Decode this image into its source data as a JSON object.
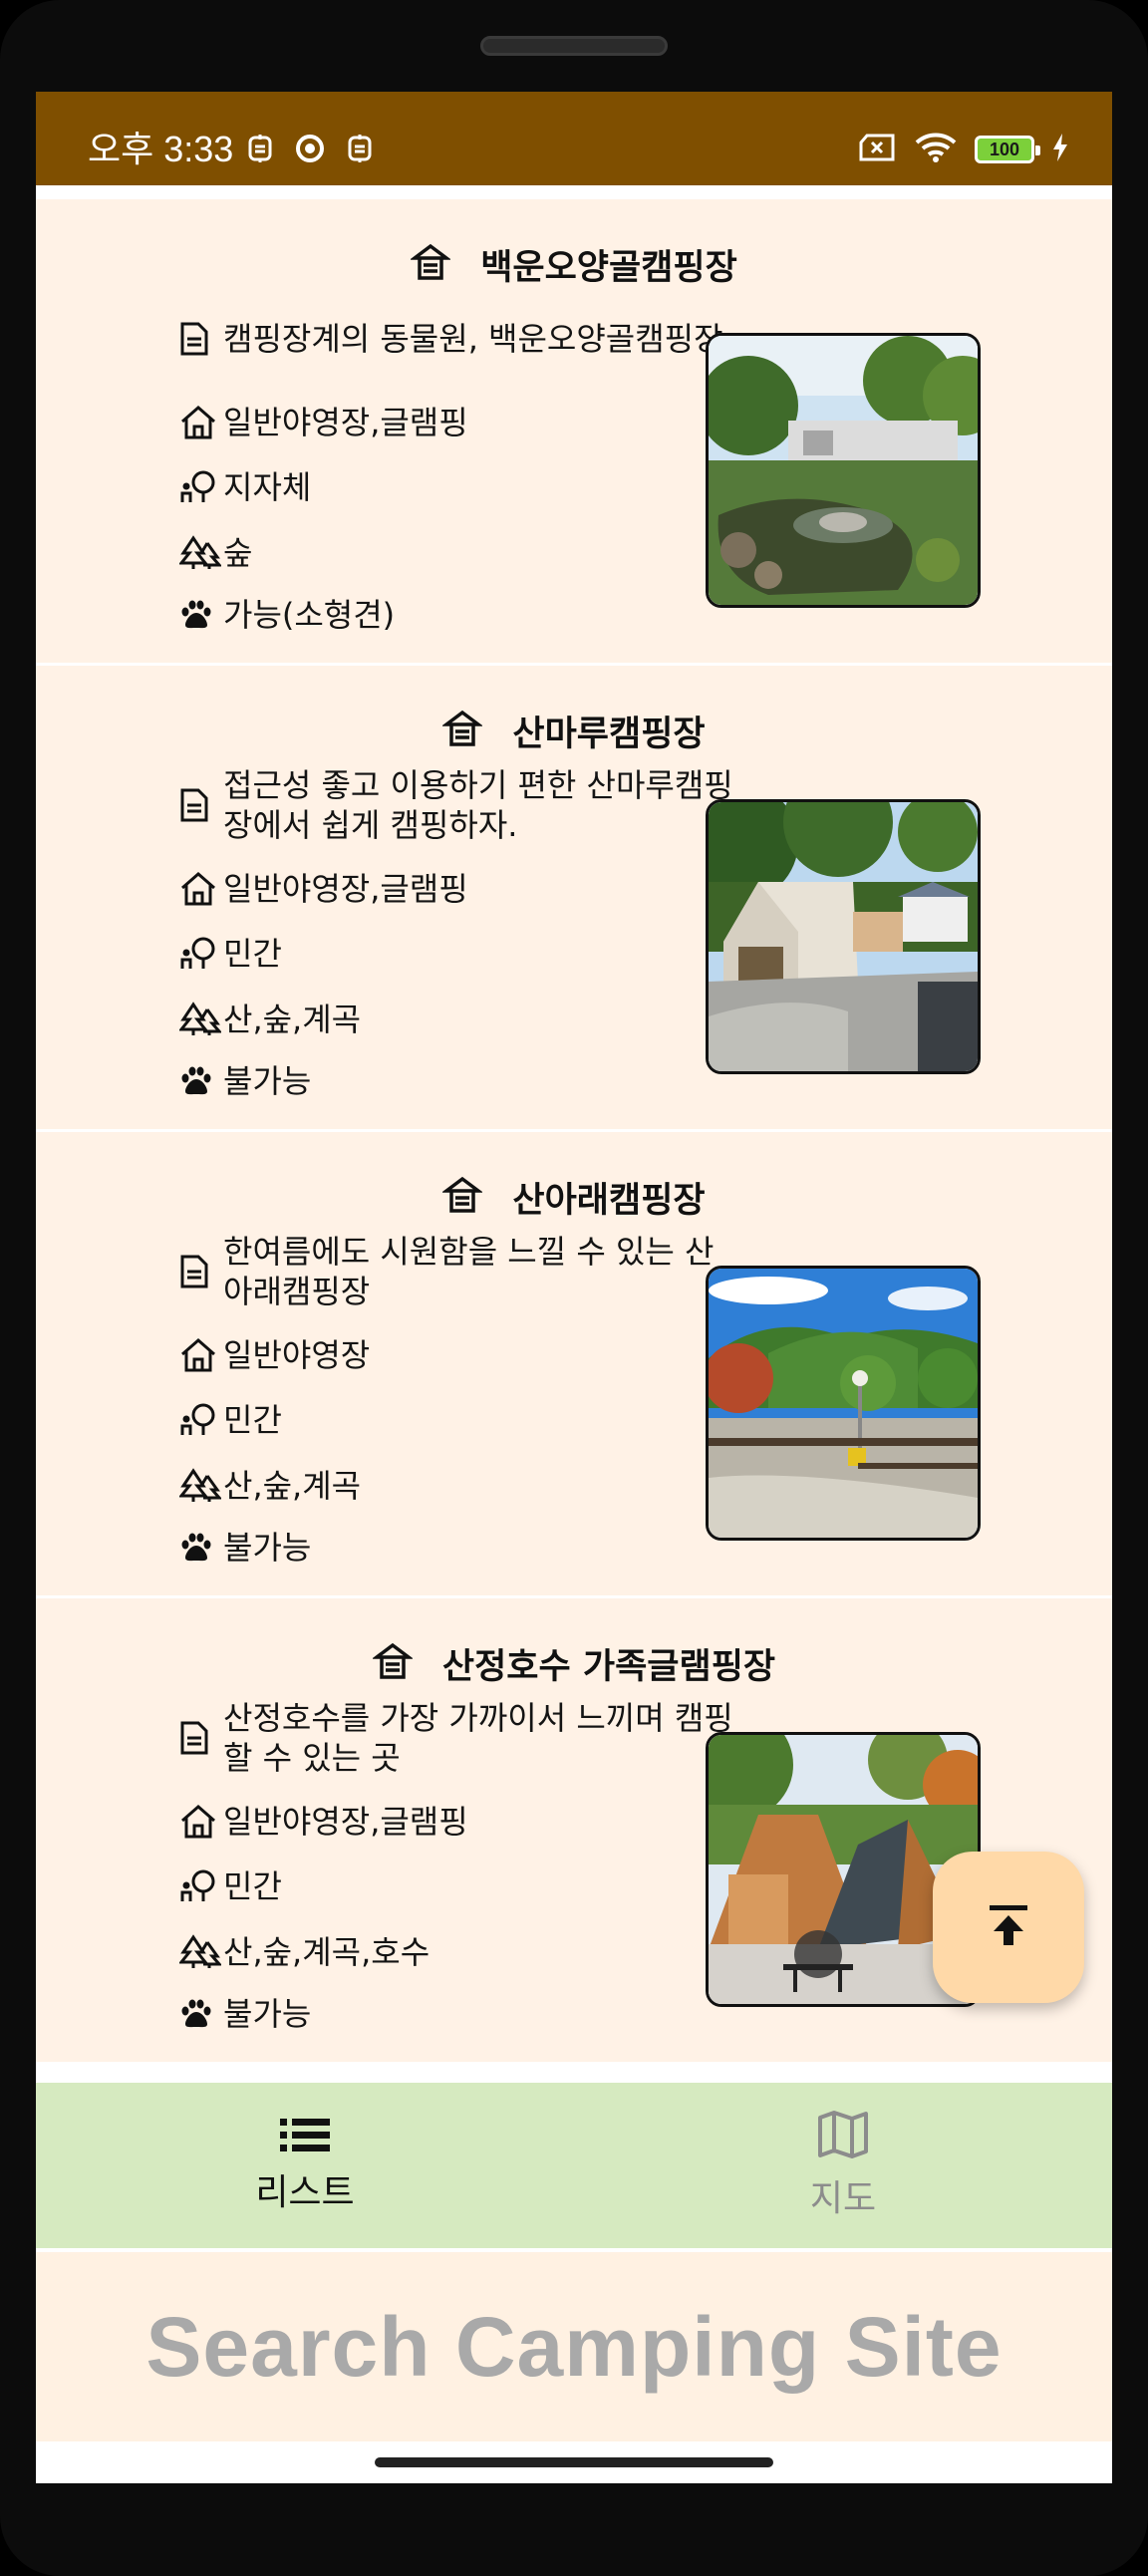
{
  "status_bar": {
    "time": "오후 3:33",
    "battery": "100",
    "background": "#7f4f00"
  },
  "sites": [
    {
      "name": "백운오양골캠핑장",
      "description": "캠핑장계의 동물원, 백운오양골캠핑장",
      "type": "일반야영장,글램핑",
      "owner": "지자체",
      "environment": "숲",
      "pets": "가능(소형견)"
    },
    {
      "name": "산마루캠핑장",
      "description": "접근성 좋고 이용하기 편한 산마루캠핑장에서 쉽게 캠핑하자.",
      "type": "일반야영장,글램핑",
      "owner": "민간",
      "environment": "산,숲,계곡",
      "pets": "불가능"
    },
    {
      "name": "산아래캠핑장",
      "description": "한여름에도 시원함을 느낄 수 있는 산아래캠핑장",
      "type": "일반야영장",
      "owner": "민간",
      "environment": "산,숲,계곡",
      "pets": "불가능"
    },
    {
      "name": "산정호수 가족글램핑장",
      "description": "산정호수를 가장 가까이서 느끼며 캠핑할 수 있는 곳",
      "type": "일반야영장,글램핑",
      "owner": "민간",
      "environment": "산,숲,계곡,호수",
      "pets": "불가능"
    }
  ],
  "bottom_nav": {
    "list_label": "리스트",
    "map_label": "지도",
    "background": "#d6eac0"
  },
  "search": {
    "label": "Search Camping Site"
  },
  "colors": {
    "card_bg": "#fff2e6",
    "fab_bg": "#ffd9a8"
  }
}
